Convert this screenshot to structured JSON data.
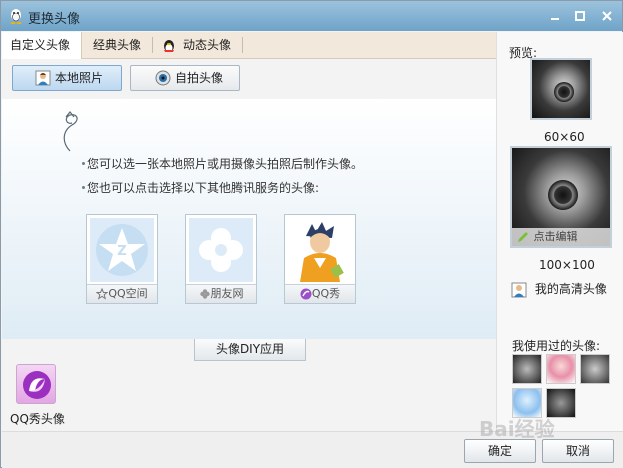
{
  "window": {
    "title": "更换头像"
  },
  "tabs": [
    {
      "label": "自定义头像"
    },
    {
      "label": "经典头像"
    },
    {
      "label": "动态头像"
    }
  ],
  "source_buttons": {
    "local": "本地照片",
    "webcam": "自拍头像"
  },
  "hints": [
    "您可以选一张本地照片或用摄像头拍照后制作头像。",
    "您也可以点击选择以下其他腾讯服务的头像:"
  ],
  "services": [
    {
      "label": "QQ空间"
    },
    {
      "label": "朋友网"
    },
    {
      "label": "QQ秀"
    }
  ],
  "diy_button": "头像DIY应用",
  "app": {
    "label": "QQ秀头像"
  },
  "preview": {
    "title": "预览:",
    "small_size": "60×60",
    "large_size": "100×100",
    "edit_label": "点击编辑",
    "hd_link": "我的高清头像"
  },
  "history": {
    "title": "我使用过的头像:"
  },
  "buttons": {
    "ok": "确定",
    "cancel": "取消"
  },
  "watermark": "Bai经验",
  "colors": {
    "titlebar": "#7fb0d2",
    "accent": "#7fa8cc"
  }
}
